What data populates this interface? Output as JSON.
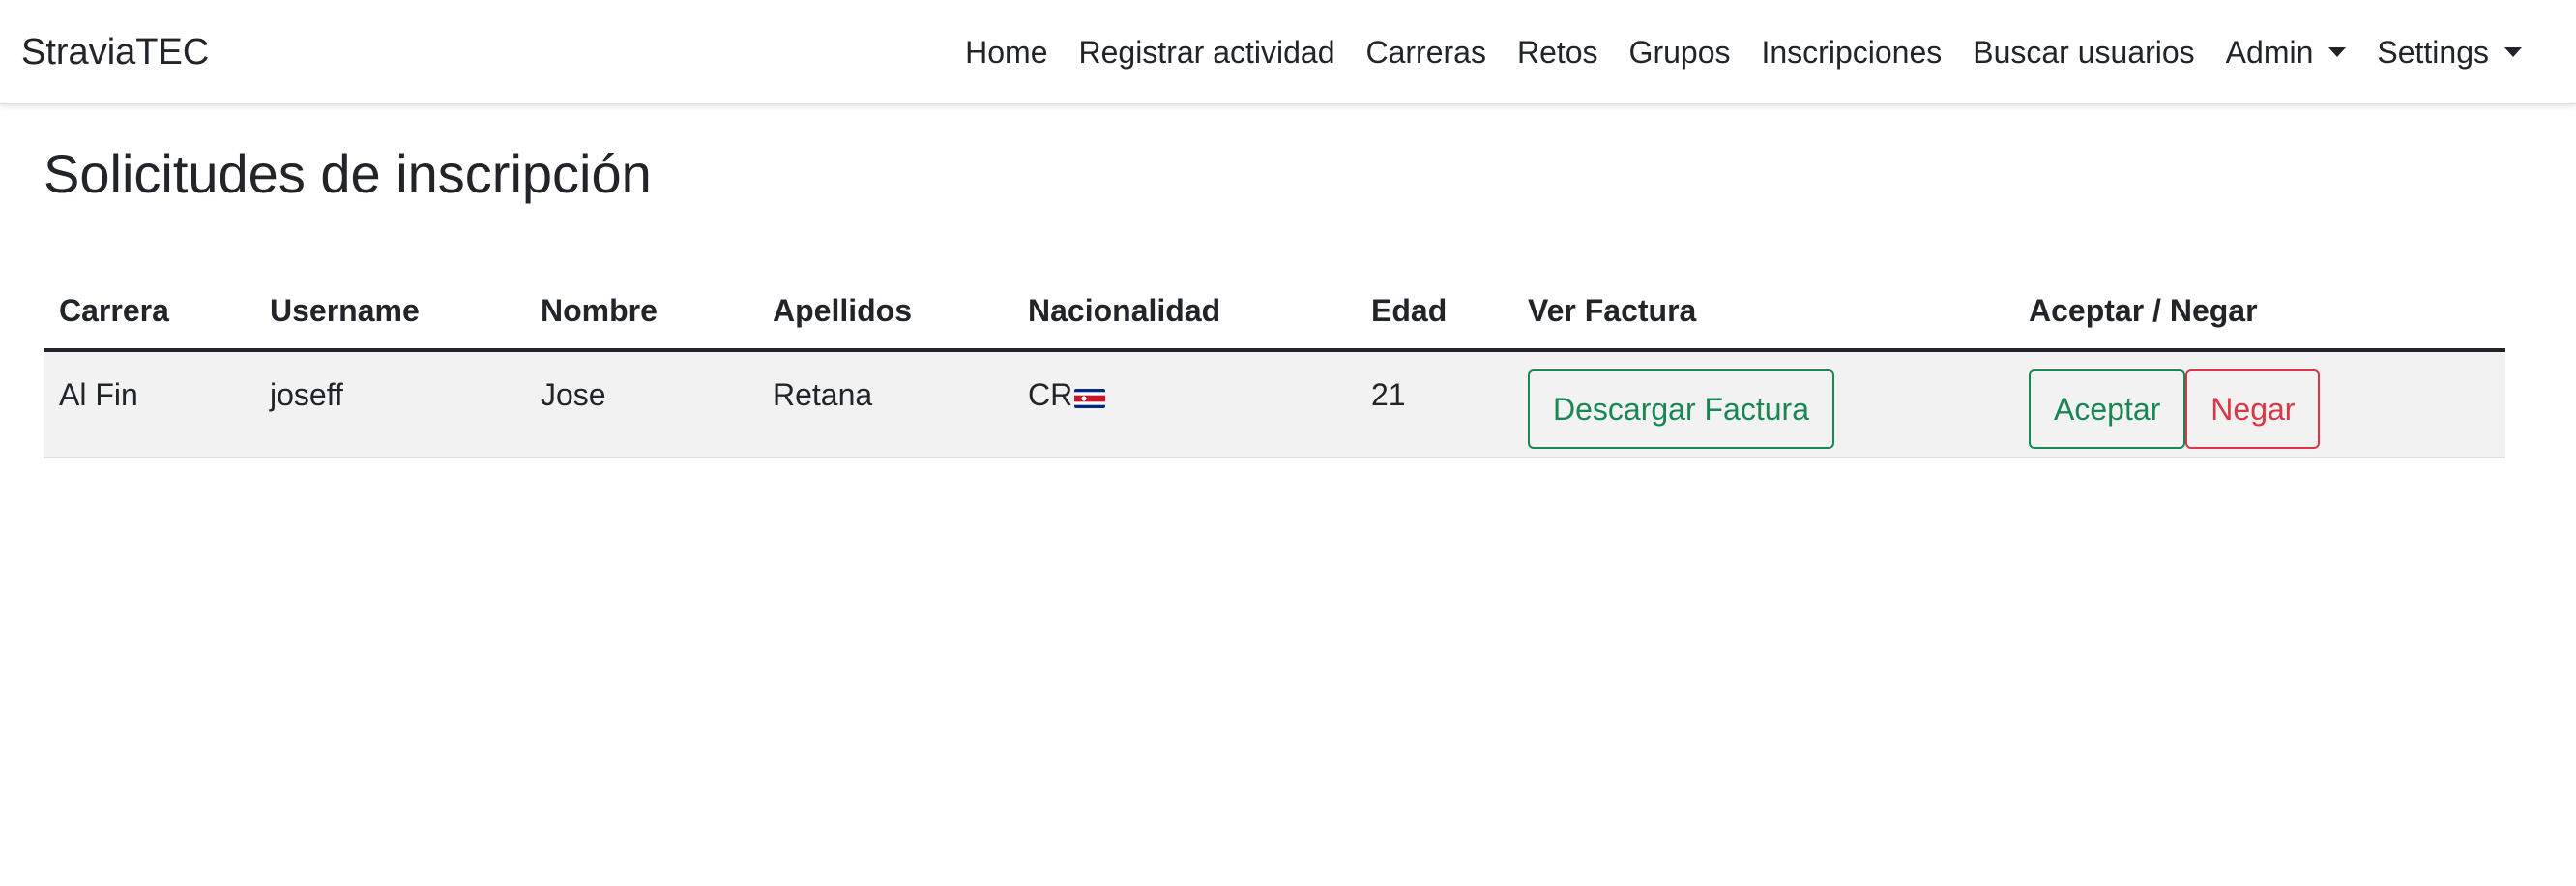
{
  "navbar": {
    "brand": "StraviaTEC",
    "links": [
      {
        "label": "Home"
      },
      {
        "label": "Registrar actividad"
      },
      {
        "label": "Carreras"
      },
      {
        "label": "Retos"
      },
      {
        "label": "Grupos"
      },
      {
        "label": "Inscripciones"
      },
      {
        "label": "Buscar usuarios"
      }
    ],
    "dropdowns": [
      {
        "label": "Admin"
      },
      {
        "label": "Settings"
      }
    ]
  },
  "page": {
    "title": "Solicitudes de inscripción"
  },
  "table": {
    "headers": [
      "Carrera",
      "Username",
      "Nombre",
      "Apellidos",
      "Nacionalidad",
      "Edad",
      "Ver Factura",
      "Aceptar / Negar"
    ],
    "rows": [
      {
        "carrera": "Al Fin",
        "username": "joseff",
        "nombre": "Jose",
        "apellidos": "Retana",
        "nacionalidad": "CR",
        "flag_icon": "costa-rica-flag-icon",
        "edad": "21",
        "download_label": "Descargar Factura",
        "accept_label": "Aceptar",
        "deny_label": "Negar"
      }
    ]
  },
  "colors": {
    "success": "#198754",
    "danger": "#dc3545",
    "row_background": "#f2f2f2",
    "text": "#212529"
  }
}
